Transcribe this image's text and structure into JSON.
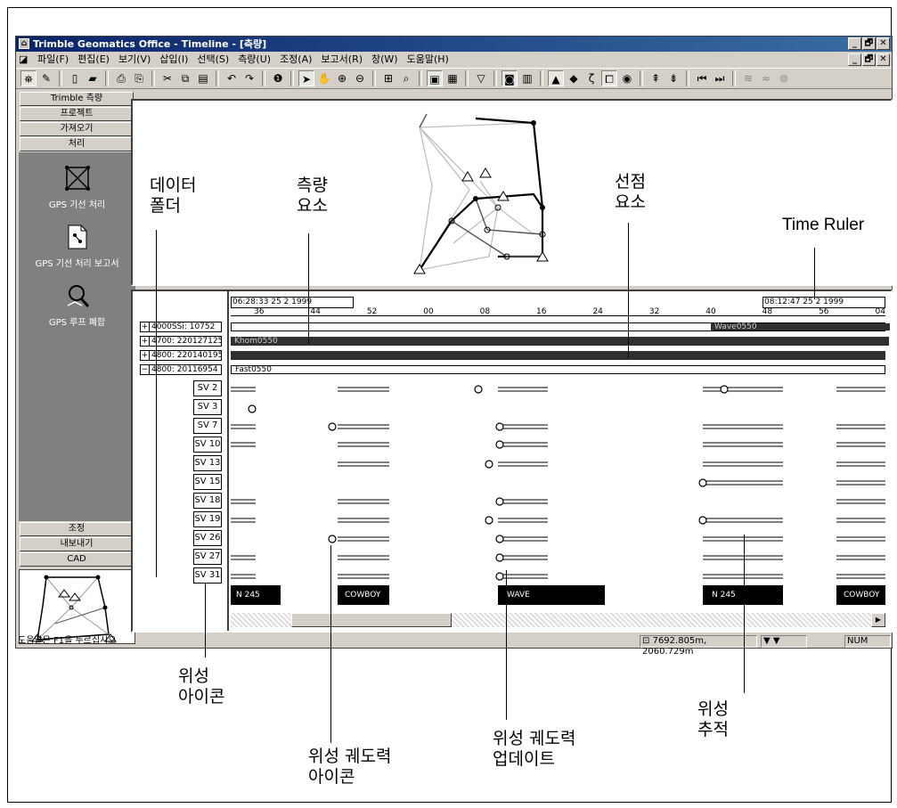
{
  "window": {
    "title": "Trimble Geomatics Office - Timeline - [측량]",
    "controls": [
      "_",
      "🗗",
      "✕"
    ]
  },
  "menu": [
    "파일(F)",
    "편집(E)",
    "보기(V)",
    "삽입(I)",
    "선택(S)",
    "측량(U)",
    "조정(A)",
    "보고서(R)",
    "창(W)",
    "도움말(H)"
  ],
  "toolbar_icons": [
    "survey-icon",
    "edit-icon",
    "new-icon",
    "open-icon",
    "print-icon",
    "print-preview-icon",
    "cut-icon",
    "copy-icon",
    "paste-icon",
    "undo-icon",
    "redo-icon",
    "info-icon",
    "select-icon",
    "pan-icon",
    "zoom-in-icon",
    "zoom-out-icon",
    "zoom-extents-icon",
    "zoom-window-icon",
    "layer-icon",
    "grid-icon",
    "filter-icon",
    "snapshot-icon",
    "table-icon",
    "triangle-icon",
    "diamond-icon",
    "curve-icon",
    "bracket-icon",
    "circle-icon",
    "sort-up-icon",
    "sort-down-icon",
    "first-icon",
    "last-icon",
    "chart-a-icon",
    "chart-b-icon",
    "chart-c-icon"
  ],
  "sidebar": {
    "top_items": [
      "Trimble 측량",
      "프로젝트",
      "가져오기",
      "처리"
    ],
    "process_items": [
      "GPS 기선 처리",
      "GPS 기선 처리 보고서",
      "GPS 루프 폐합"
    ],
    "bottom_items": [
      "조정",
      "내보내기",
      "CAD"
    ]
  },
  "timeline": {
    "start_time": "06:28:33 25 2 1999",
    "end_time": "08:12:47 25 2 1999",
    "ticks": [
      "36",
      "44",
      "52",
      "00",
      "08",
      "16",
      "24",
      "32",
      "40",
      "48",
      "56",
      "04"
    ],
    "receivers": [
      {
        "sign": "+",
        "label": "4000SSi: 10752",
        "file": "Wave0550"
      },
      {
        "sign": "+",
        "label": "4700: 220127125",
        "file": "Khom0550"
      },
      {
        "sign": "+",
        "label": "4800: 220140195",
        "file": ""
      },
      {
        "sign": "−",
        "label": "4800: 20116954",
        "file": "Fast0550"
      }
    ],
    "satellites": [
      "SV 2",
      "SV 3",
      "SV 7",
      "SV 10",
      "SV 13",
      "SV 15",
      "SV 18",
      "SV 19",
      "SV 26",
      "SV 27",
      "SV 31"
    ],
    "points": [
      "N 245",
      "COWBOY",
      "WAVE",
      "N 245",
      "COWBOY"
    ]
  },
  "status": {
    "help": "도움말은 F1을 누르십시오",
    "coords": "7692.805m, 2060.729m",
    "num": "NUM"
  },
  "annotations": {
    "data_folder": "데이터\n폴더",
    "survey_element": "측량\n요소",
    "occupation_element": "선점\n요소",
    "time_ruler": "Time Ruler",
    "satellite_icon": "위성\n아이콘",
    "ephemeris_icon": "위성 궤도력\n아이콘",
    "ephemeris_update": "위성 궤도력\n업데이트",
    "satellite_tracking": "위성\n추적"
  }
}
